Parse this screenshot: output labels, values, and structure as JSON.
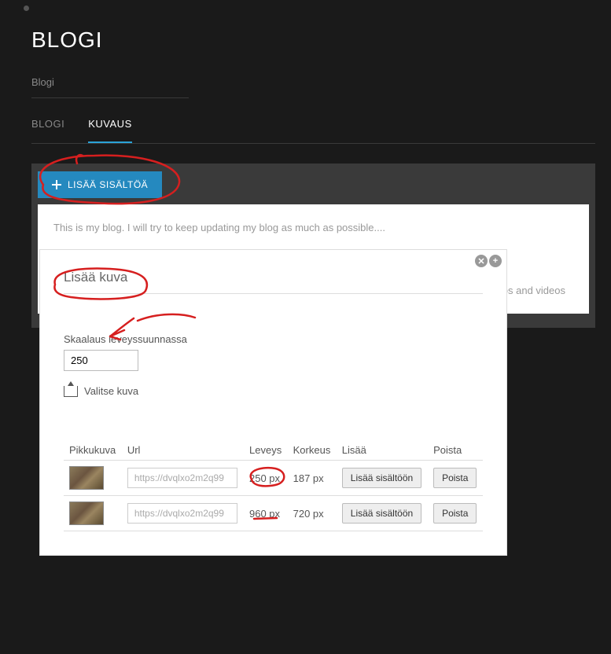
{
  "page": {
    "title": "BLOGI",
    "breadcrumb": "Blogi",
    "tabs": [
      "BLOGI",
      "KUVAUS"
    ],
    "active_tab": 1
  },
  "toolbar": {
    "add_label": "LISÄÄ SISÄLTÖÄ"
  },
  "content": {
    "intro": "This is my blog. I will try to keep updating my blog as much as possible....",
    "hint_suffix": "s, photos and videos"
  },
  "modal": {
    "title": "Lisää kuva",
    "scale_label": "Skaalaus leveyssuunnassa",
    "scale_value": "250",
    "choose_label": "Valitse kuva",
    "headers": {
      "thumb": "Pikkukuva",
      "url": "Url",
      "width": "Leveys",
      "height": "Korkeus",
      "add": "Lisää",
      "remove": "Poista"
    },
    "rows": [
      {
        "url": "https://dvqlxo2m2q99",
        "width": "250 px",
        "height": "187 px",
        "add_label": "Lisää sisältöön",
        "remove_label": "Poista"
      },
      {
        "url": "https://dvqlxo2m2q99",
        "width": "960 px",
        "height": "720 px",
        "add_label": "Lisää sisältöön",
        "remove_label": "Poista"
      }
    ]
  }
}
